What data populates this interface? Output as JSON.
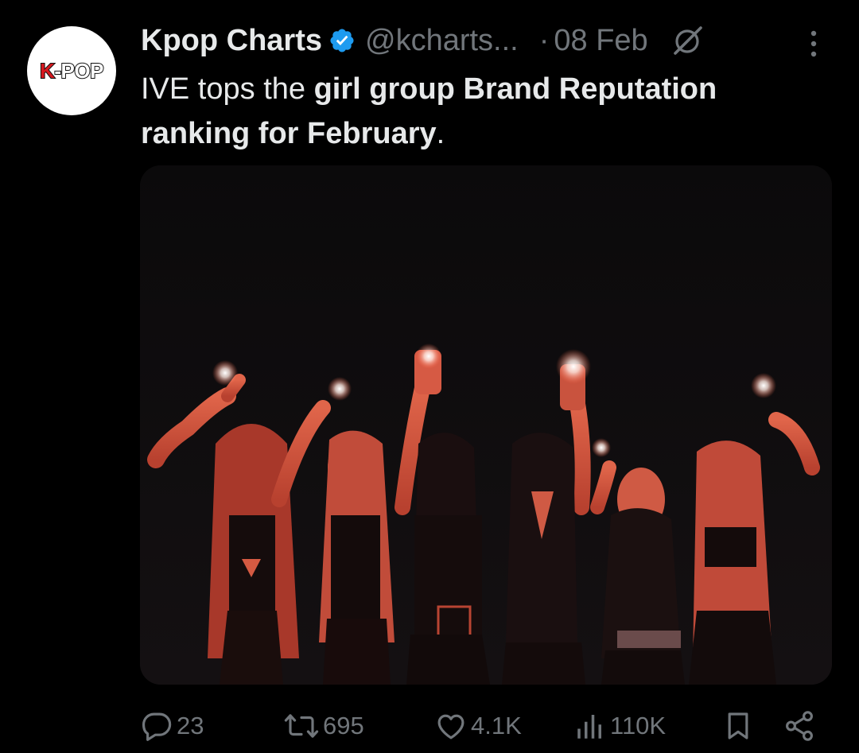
{
  "tweet": {
    "avatar_logo_k": "K",
    "avatar_logo_rest": "-POP",
    "display_name": "Kpop Charts",
    "handle": "@kcharts...",
    "separator": "·",
    "date": "08 Feb",
    "text_part1": "IVE tops the ",
    "text_bold": "girl group Brand Reputation ranking for February",
    "text_end": ".",
    "media_icon": "photo-image",
    "verified_icon": "verified-badge-icon",
    "grok_icon": "grok-icon",
    "more_icon": "more-options-icon"
  },
  "actions": {
    "replies": {
      "icon": "reply-icon",
      "count": "23"
    },
    "reposts": {
      "icon": "repost-icon",
      "count": "695"
    },
    "likes": {
      "icon": "like-icon",
      "count": "4.1K"
    },
    "views": {
      "icon": "views-icon",
      "count": "110K"
    },
    "bookmark": {
      "icon": "bookmark-icon"
    },
    "share": {
      "icon": "share-icon"
    }
  },
  "colors": {
    "background": "#000000",
    "text": "#e7e9ea",
    "muted": "#71767b",
    "verified": "#1d9bf0",
    "photo_tint": "#d6553e"
  }
}
